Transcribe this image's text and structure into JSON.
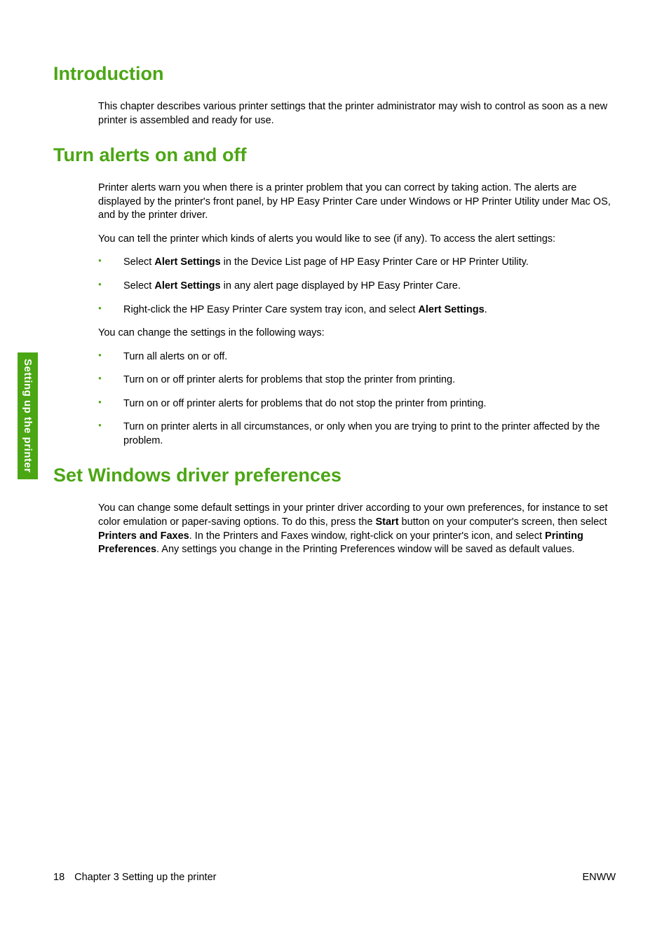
{
  "sideTab": "Setting up the printer",
  "section1": {
    "heading": "Introduction",
    "p1": "This chapter describes various printer settings that the printer administrator may wish to control as soon as a new printer is assembled and ready for use."
  },
  "section2": {
    "heading": "Turn alerts on and off",
    "p1": "Printer alerts warn you when there is a printer problem that you can correct by taking action. The alerts are displayed by the printer's front panel, by HP Easy Printer Care under Windows or HP Printer Utility under Mac OS, and by the printer driver.",
    "p2": "You can tell the printer which kinds of alerts you would like to see (if any). To access the alert settings:",
    "list1": {
      "item1_pre": "Select ",
      "item1_bold": "Alert Settings",
      "item1_post": " in the Device List page of HP Easy Printer Care or HP Printer Utility.",
      "item2_pre": "Select ",
      "item2_bold": "Alert Settings",
      "item2_post": " in any alert page displayed by HP Easy Printer Care.",
      "item3_pre": "Right-click the HP Easy Printer Care system tray icon, and select ",
      "item3_bold": "Alert Settings",
      "item3_post": "."
    },
    "p3": "You can change the settings in the following ways:",
    "list2": {
      "item1": "Turn all alerts on or off.",
      "item2": "Turn on or off printer alerts for problems that stop the printer from printing.",
      "item3": "Turn on or off printer alerts for problems that do not stop the printer from printing.",
      "item4": "Turn on printer alerts in all circumstances, or only when you are trying to print to the printer affected by the problem."
    }
  },
  "section3": {
    "heading": "Set Windows driver preferences",
    "p1_part1": "You can change some default settings in your printer driver according to your own preferences, for instance to set color emulation or paper-saving options. To do this, press the ",
    "p1_bold1": "Start",
    "p1_part2": " button on your computer's screen, then select ",
    "p1_bold2": "Printers and Faxes",
    "p1_part3": ". In the Printers and Faxes window, right-click on your printer's icon, and select ",
    "p1_bold3": "Printing Preferences",
    "p1_part4": ". Any settings you change in the Printing Preferences window will be saved as default values."
  },
  "footer": {
    "pageNum": "18",
    "chapter": "Chapter 3   Setting up the printer",
    "right": "ENWW"
  }
}
